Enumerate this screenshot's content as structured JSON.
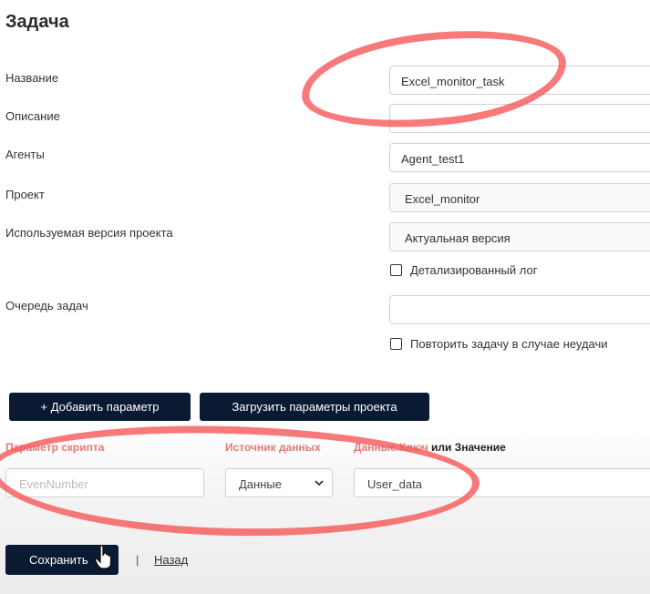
{
  "form": {
    "title": "Задача",
    "labels": {
      "name": "Название",
      "description": "Описание",
      "agents": "Агенты",
      "project": "Проект",
      "project_version": "Используемая версия проекта",
      "queue": "Очередь задач"
    },
    "values": {
      "name": "Excel_monitor_task",
      "description": "",
      "agents": "Agent_test1",
      "project": "Excel_monitor",
      "project_version": "Актуальная версия",
      "queue": ""
    },
    "checkboxes": {
      "detailed_log": "Детализированный лог",
      "retry_on_fail": "Повторить задачу в случае неудачи"
    }
  },
  "buttons": {
    "add_param": "+ Добавить параметр",
    "load_params": "Загрузить параметры проекта",
    "save": "Сохранить",
    "back": "Назад",
    "separator": "|"
  },
  "params": {
    "headers": {
      "param": "Параметр скрипта",
      "source": "Источник данных",
      "key_part": "Данные.Ключ",
      "value_part": " или Значение"
    },
    "row": {
      "param": "EvenNumber",
      "source": "Данные",
      "value": "User_data"
    }
  },
  "colors": {
    "button_bg": "#0b1a33",
    "marker": "#f65858"
  },
  "icons": {
    "dropdown": "chevron-down-icon",
    "cursor": "hand-cursor-icon"
  }
}
